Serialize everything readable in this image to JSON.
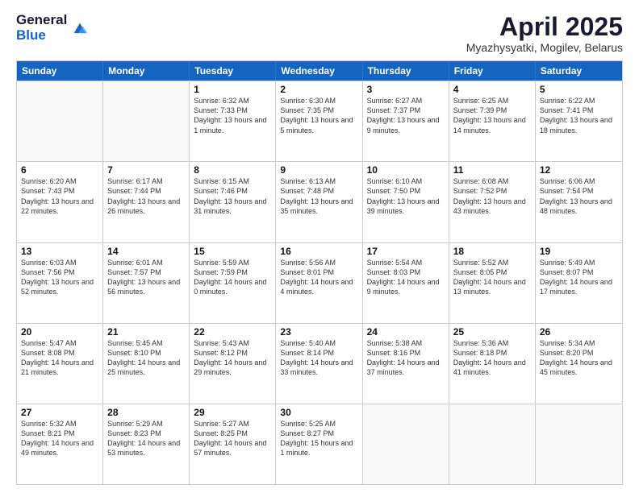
{
  "logo": {
    "general": "General",
    "blue": "Blue"
  },
  "title": "April 2025",
  "subtitle": "Myazhysyatki, Mogilev, Belarus",
  "headers": [
    "Sunday",
    "Monday",
    "Tuesday",
    "Wednesday",
    "Thursday",
    "Friday",
    "Saturday"
  ],
  "weeks": [
    [
      {
        "day": "",
        "info": ""
      },
      {
        "day": "",
        "info": ""
      },
      {
        "day": "1",
        "info": "Sunrise: 6:32 AM\nSunset: 7:33 PM\nDaylight: 13 hours and 1 minute."
      },
      {
        "day": "2",
        "info": "Sunrise: 6:30 AM\nSunset: 7:35 PM\nDaylight: 13 hours and 5 minutes."
      },
      {
        "day": "3",
        "info": "Sunrise: 6:27 AM\nSunset: 7:37 PM\nDaylight: 13 hours and 9 minutes."
      },
      {
        "day": "4",
        "info": "Sunrise: 6:25 AM\nSunset: 7:39 PM\nDaylight: 13 hours and 14 minutes."
      },
      {
        "day": "5",
        "info": "Sunrise: 6:22 AM\nSunset: 7:41 PM\nDaylight: 13 hours and 18 minutes."
      }
    ],
    [
      {
        "day": "6",
        "info": "Sunrise: 6:20 AM\nSunset: 7:43 PM\nDaylight: 13 hours and 22 minutes."
      },
      {
        "day": "7",
        "info": "Sunrise: 6:17 AM\nSunset: 7:44 PM\nDaylight: 13 hours and 26 minutes."
      },
      {
        "day": "8",
        "info": "Sunrise: 6:15 AM\nSunset: 7:46 PM\nDaylight: 13 hours and 31 minutes."
      },
      {
        "day": "9",
        "info": "Sunrise: 6:13 AM\nSunset: 7:48 PM\nDaylight: 13 hours and 35 minutes."
      },
      {
        "day": "10",
        "info": "Sunrise: 6:10 AM\nSunset: 7:50 PM\nDaylight: 13 hours and 39 minutes."
      },
      {
        "day": "11",
        "info": "Sunrise: 6:08 AM\nSunset: 7:52 PM\nDaylight: 13 hours and 43 minutes."
      },
      {
        "day": "12",
        "info": "Sunrise: 6:06 AM\nSunset: 7:54 PM\nDaylight: 13 hours and 48 minutes."
      }
    ],
    [
      {
        "day": "13",
        "info": "Sunrise: 6:03 AM\nSunset: 7:56 PM\nDaylight: 13 hours and 52 minutes."
      },
      {
        "day": "14",
        "info": "Sunrise: 6:01 AM\nSunset: 7:57 PM\nDaylight: 13 hours and 56 minutes."
      },
      {
        "day": "15",
        "info": "Sunrise: 5:59 AM\nSunset: 7:59 PM\nDaylight: 14 hours and 0 minutes."
      },
      {
        "day": "16",
        "info": "Sunrise: 5:56 AM\nSunset: 8:01 PM\nDaylight: 14 hours and 4 minutes."
      },
      {
        "day": "17",
        "info": "Sunrise: 5:54 AM\nSunset: 8:03 PM\nDaylight: 14 hours and 9 minutes."
      },
      {
        "day": "18",
        "info": "Sunrise: 5:52 AM\nSunset: 8:05 PM\nDaylight: 14 hours and 13 minutes."
      },
      {
        "day": "19",
        "info": "Sunrise: 5:49 AM\nSunset: 8:07 PM\nDaylight: 14 hours and 17 minutes."
      }
    ],
    [
      {
        "day": "20",
        "info": "Sunrise: 5:47 AM\nSunset: 8:08 PM\nDaylight: 14 hours and 21 minutes."
      },
      {
        "day": "21",
        "info": "Sunrise: 5:45 AM\nSunset: 8:10 PM\nDaylight: 14 hours and 25 minutes."
      },
      {
        "day": "22",
        "info": "Sunrise: 5:43 AM\nSunset: 8:12 PM\nDaylight: 14 hours and 29 minutes."
      },
      {
        "day": "23",
        "info": "Sunrise: 5:40 AM\nSunset: 8:14 PM\nDaylight: 14 hours and 33 minutes."
      },
      {
        "day": "24",
        "info": "Sunrise: 5:38 AM\nSunset: 8:16 PM\nDaylight: 14 hours and 37 minutes."
      },
      {
        "day": "25",
        "info": "Sunrise: 5:36 AM\nSunset: 8:18 PM\nDaylight: 14 hours and 41 minutes."
      },
      {
        "day": "26",
        "info": "Sunrise: 5:34 AM\nSunset: 8:20 PM\nDaylight: 14 hours and 45 minutes."
      }
    ],
    [
      {
        "day": "27",
        "info": "Sunrise: 5:32 AM\nSunset: 8:21 PM\nDaylight: 14 hours and 49 minutes."
      },
      {
        "day": "28",
        "info": "Sunrise: 5:29 AM\nSunset: 8:23 PM\nDaylight: 14 hours and 53 minutes."
      },
      {
        "day": "29",
        "info": "Sunrise: 5:27 AM\nSunset: 8:25 PM\nDaylight: 14 hours and 57 minutes."
      },
      {
        "day": "30",
        "info": "Sunrise: 5:25 AM\nSunset: 8:27 PM\nDaylight: 15 hours and 1 minute."
      },
      {
        "day": "",
        "info": ""
      },
      {
        "day": "",
        "info": ""
      },
      {
        "day": "",
        "info": ""
      }
    ]
  ]
}
